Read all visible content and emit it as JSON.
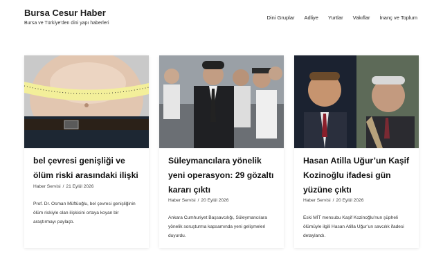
{
  "site": {
    "title": "Bursa Cesur Haber",
    "tagline": "Bursa ve Türkiye'den dini yapı haberleri"
  },
  "nav": {
    "items": [
      {
        "label": "Dini Gruplar"
      },
      {
        "label": "Adliye"
      },
      {
        "label": "Yurtlar"
      },
      {
        "label": "Vakıflar"
      },
      {
        "label": "İnanç ve Toplum"
      }
    ]
  },
  "articles": [
    {
      "title": "bel çevresi genişliği ve ölüm riski arasındaki ilişki",
      "author": "Haber Servisi",
      "separator": "/",
      "date": "21 Eylül 2026",
      "excerpt": "Prof. Dr. Osman Müftüoğlu, bel çevresi genişliğinin ölüm riskiyle olan ilişkisini ortaya koyan bir araştırmayı paylaştı."
    },
    {
      "title": "Süleymancılara yönelik yeni operasyon: 29 gözaltı kararı çıktı",
      "author": "Haber Servisi",
      "separator": "/",
      "date": "20 Eylül 2026",
      "excerpt": "Ankara Cumhuriyet Başsavcılığı, Süleymancılara yönelik soruşturma kapsamında yeni gelişmeleri duyurdu."
    },
    {
      "title": "Hasan Atilla Uğur’un Kaşif Kozinoğlu ifadesi gün yüzüne çıktı",
      "author": "Haber Servisi",
      "separator": "/",
      "date": "20 Eylül 2026",
      "excerpt": "Eski MİT mensubu Kaşif Kozinoğlu’nun şüpheli ölümüyle ilgili Hasan Atilla Uğur’un savcılık ifadesi detaylandı."
    }
  ]
}
